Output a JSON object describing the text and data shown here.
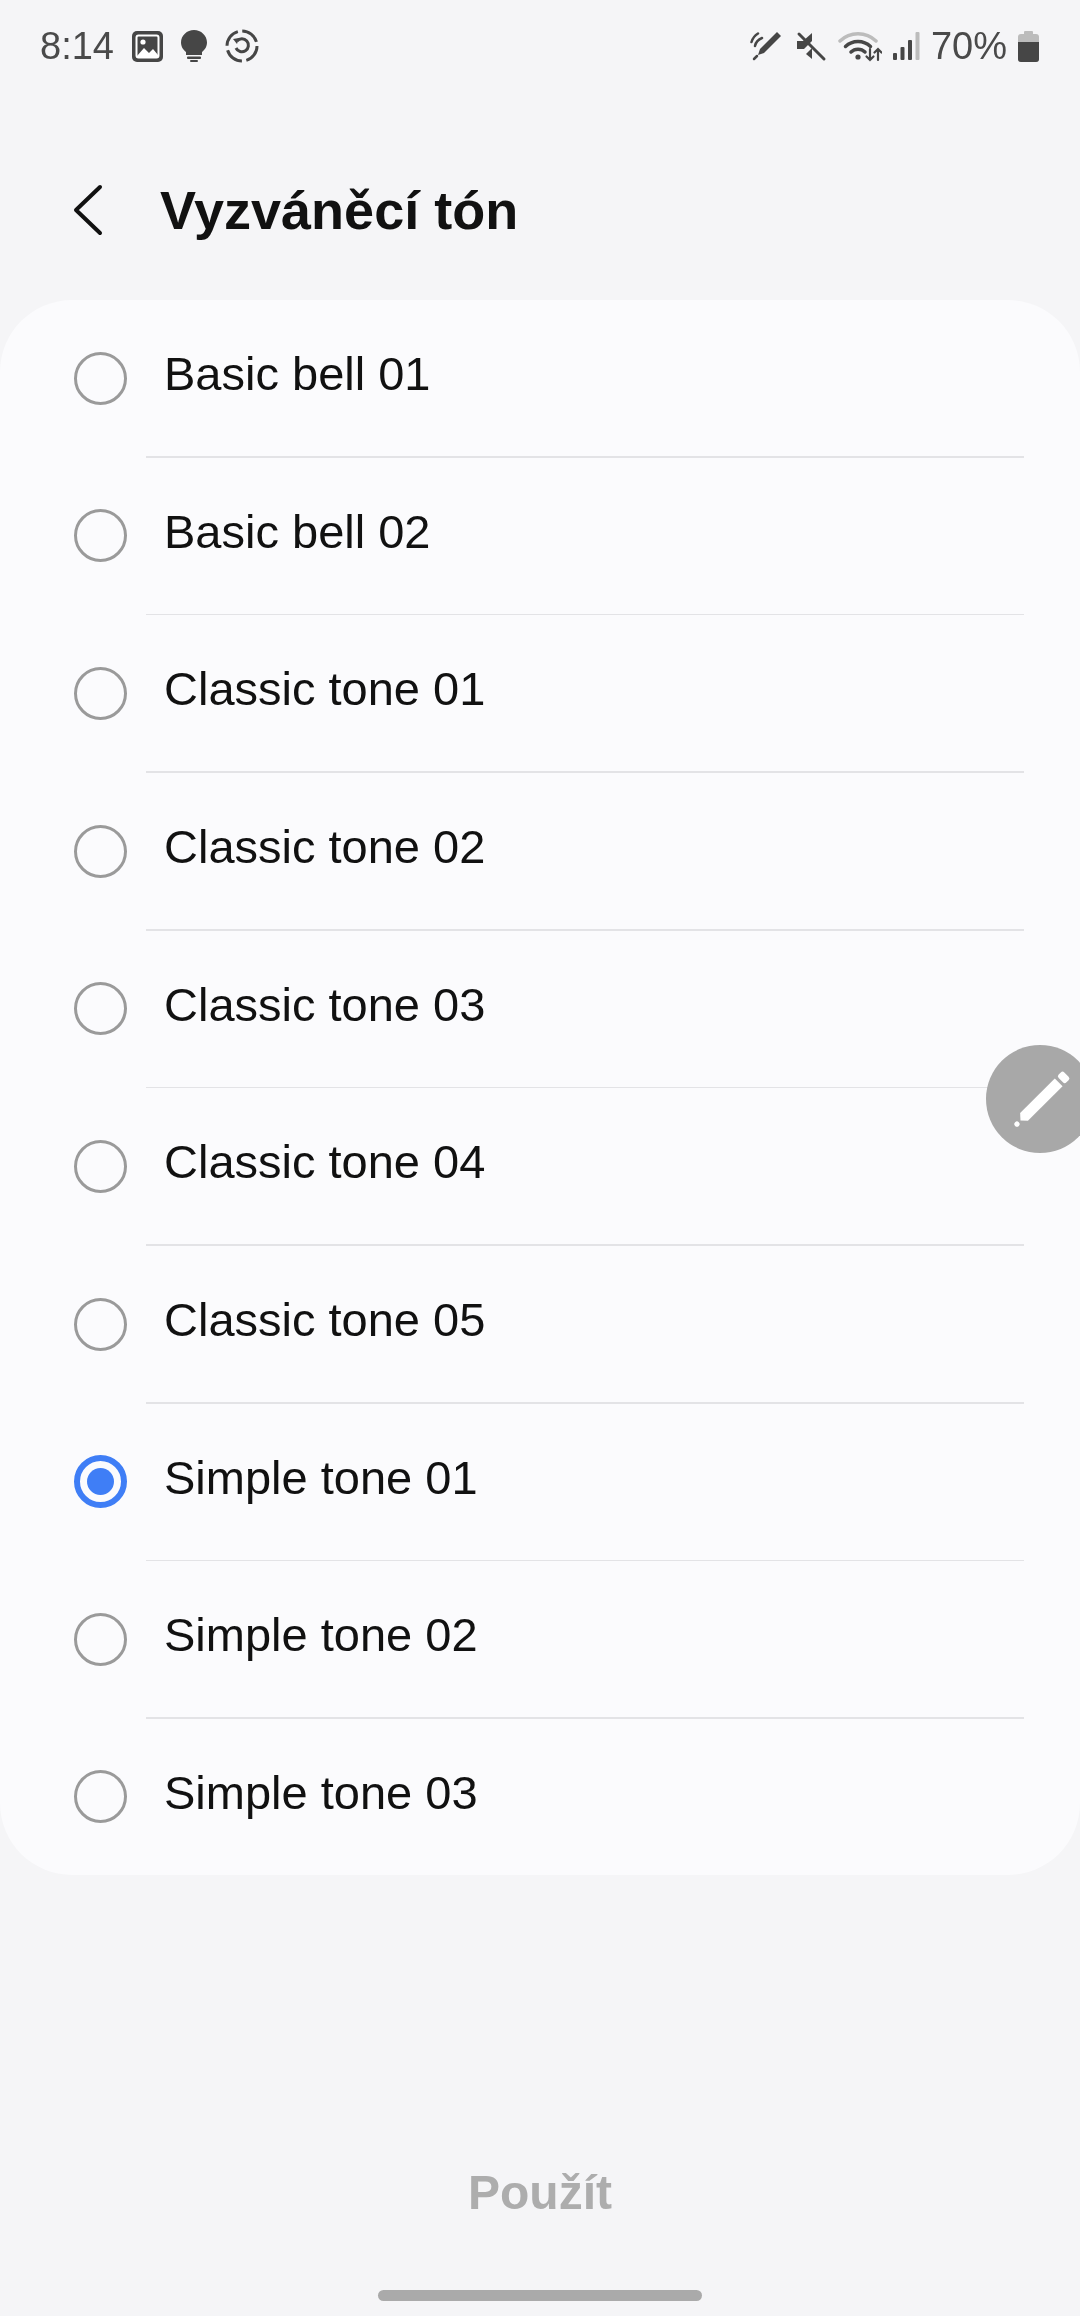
{
  "status_bar": {
    "time": "8:14",
    "battery": "70%"
  },
  "header": {
    "title": "Vyzváněcí tón"
  },
  "ringtones": [
    {
      "label": "Basic bell 01",
      "selected": false
    },
    {
      "label": "Basic bell 02",
      "selected": false
    },
    {
      "label": "Classic tone 01",
      "selected": false
    },
    {
      "label": "Classic tone 02",
      "selected": false
    },
    {
      "label": "Classic tone 03",
      "selected": false
    },
    {
      "label": "Classic tone 04",
      "selected": false
    },
    {
      "label": "Classic tone 05",
      "selected": false
    },
    {
      "label": "Simple tone 01",
      "selected": true
    },
    {
      "label": "Simple tone 02",
      "selected": false
    },
    {
      "label": "Simple tone 03",
      "selected": false
    }
  ],
  "apply_button": {
    "label": "Použít",
    "disabled": true
  }
}
